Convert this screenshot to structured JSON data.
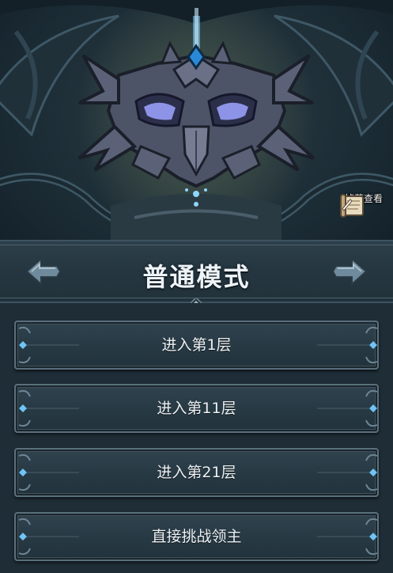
{
  "loot_button": {
    "label": "掉落查看",
    "icon": "scroll-icon"
  },
  "mode_selector": {
    "title": "普通模式",
    "prev_icon": "arrow-left-icon",
    "next_icon": "arrow-right-icon"
  },
  "floor_buttons": [
    {
      "label": "进入第1层"
    },
    {
      "label": "进入第11层"
    },
    {
      "label": "进入第21层"
    },
    {
      "label": "直接挑战领主"
    }
  ],
  "colors": {
    "background": "#1d2d36",
    "button_fill": "#263842",
    "button_border": "#5a6f7c",
    "gem_blue": "#5fb6f0",
    "text": "#eef1f4"
  }
}
